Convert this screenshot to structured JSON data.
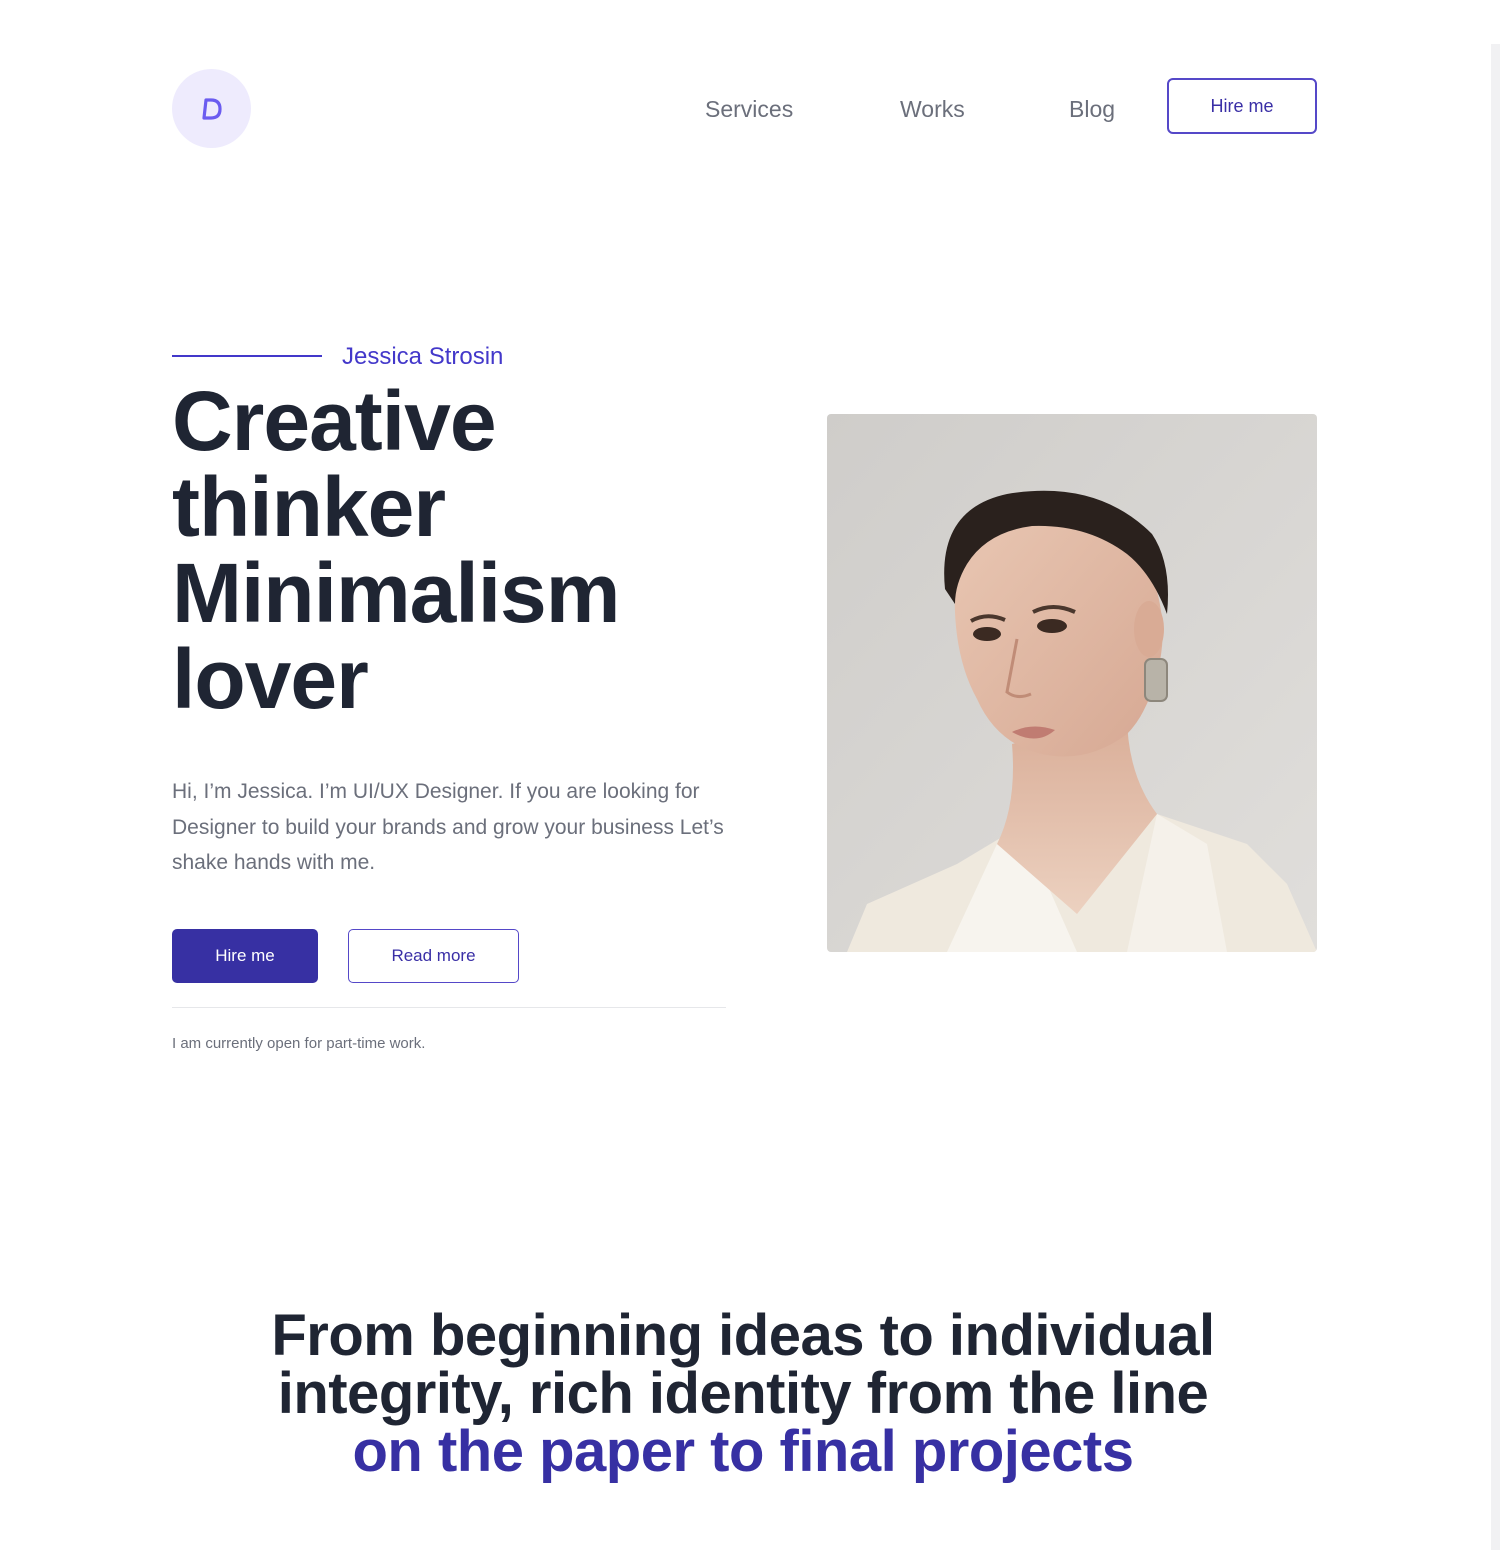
{
  "nav": {
    "logo_icon": "d-logo-icon",
    "links": [
      "Services",
      "Works",
      "Blog"
    ],
    "hire_label": "Hire me"
  },
  "hero": {
    "eyebrow": "Jessica Strosin",
    "title_lines": [
      "Creative",
      "thinker",
      "Minimalism",
      "lover"
    ],
    "description": "Hi, I’m Jessica. I’m UI/UX Designer. If you are looking for Designer to build your brands and grow your business Let’s shake hands with me.",
    "primary_button": "Hire me",
    "secondary_button": "Read more",
    "availability": "I am currently open for part-time work."
  },
  "tagline": {
    "line1": "From beginning ideas to individual",
    "line2": "integrity, rich identity from the line",
    "line3": "on the paper to final projects"
  },
  "colors": {
    "accent": "#3730a3",
    "accent_light": "#eeebfd",
    "text_dark": "#1f2533",
    "text_muted": "#6b6f7b"
  }
}
